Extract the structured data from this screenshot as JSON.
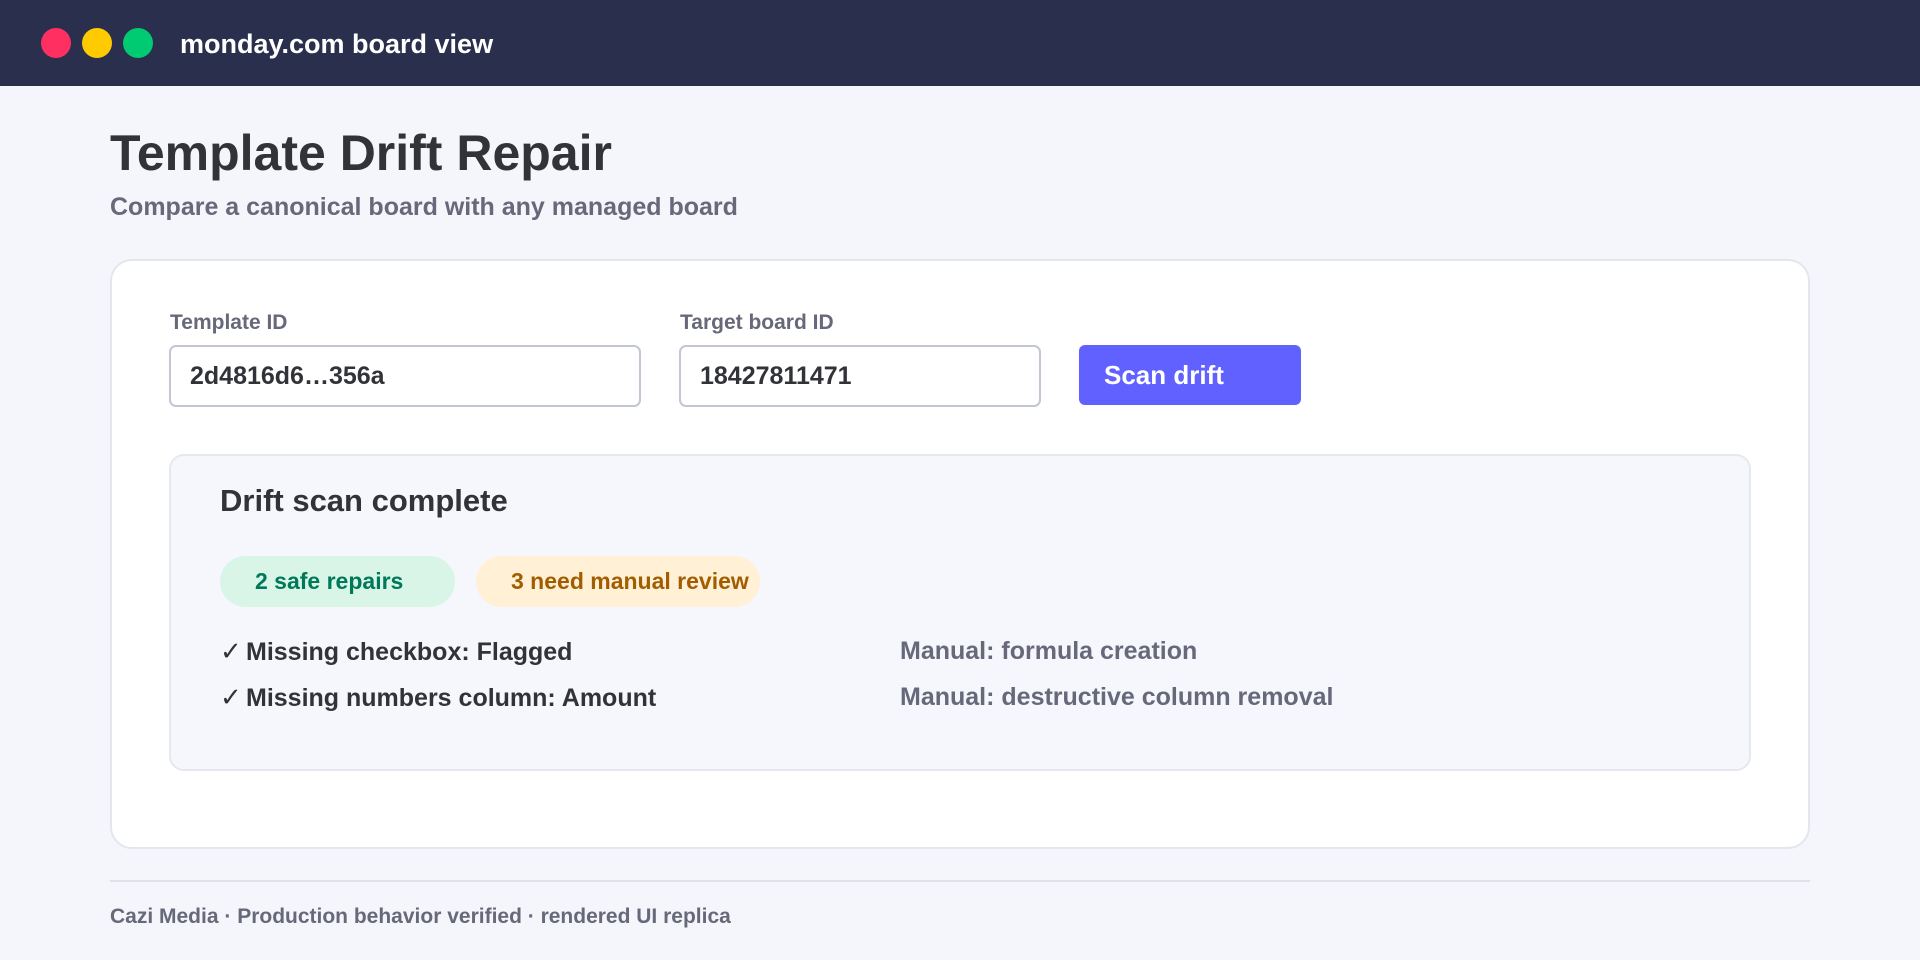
{
  "window": {
    "title": "monday.com board view",
    "controls": {
      "close_color": "#ff3061",
      "minimize_color": "#ffcb00",
      "maximize_color": "#00ca72"
    }
  },
  "page": {
    "title": "Template Drift Repair",
    "subtitle": "Compare a canonical board with any managed board"
  },
  "form": {
    "template_id": {
      "label": "Template ID",
      "value": "2d4816d6…356a"
    },
    "target_board_id": {
      "label": "Target board ID",
      "value": "18427811471"
    },
    "scan_button": "Scan drift"
  },
  "result": {
    "title": "Drift scan complete",
    "safe_badge": "2 safe repairs",
    "manual_badge": "3 need manual review",
    "check_icon": "check-icon",
    "safe_repairs": [
      "Missing checkbox: Flagged",
      "Missing numbers column: Amount"
    ],
    "manual_items": [
      "Manual: formula creation",
      "Manual: destructive column removal"
    ]
  },
  "footer": {
    "text": "Cazi Media · Production behavior verified · rendered UI replica"
  },
  "colors": {
    "accent": "#6161ff",
    "titlebar": "#292f4c",
    "safe_badge_bg": "#d9f5e8",
    "safe_badge_text": "#00795a",
    "manual_badge_bg": "#fff0d6",
    "manual_badge_text": "#a25d00"
  }
}
